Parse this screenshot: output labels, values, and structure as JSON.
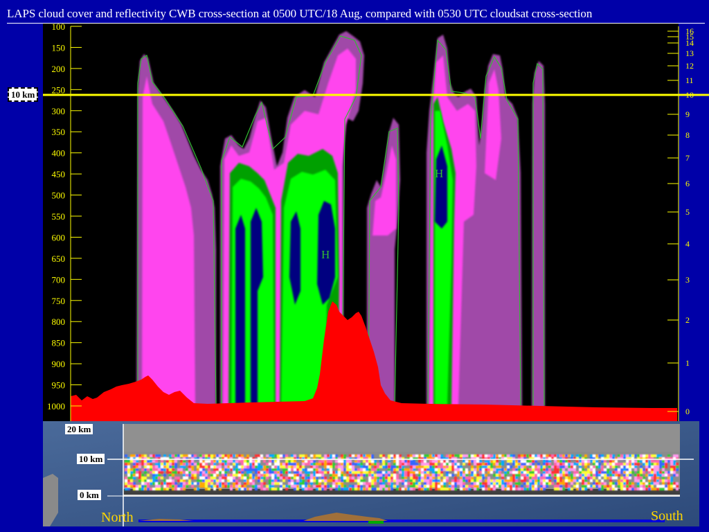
{
  "title": "LAPS cloud cover and reflectivity CWB cross-section at 0500 UTC/18 Aug, compared with 0530 UTC cloudsat cross-section",
  "chart_data": [
    {
      "type": "heatmap",
      "name": "LAPS cloud cover and reflectivity cross-section",
      "y_left_label": "",
      "y_left_ticks": [
        "100",
        "150",
        "200",
        "250",
        "300",
        "350",
        "400",
        "450",
        "500",
        "550",
        "600",
        "650",
        "700",
        "750",
        "800",
        "850",
        "900",
        "950",
        "1000"
      ],
      "y_left_range": [
        100,
        1000
      ],
      "y_right_ticks": [
        "16",
        "15",
        "14",
        "13",
        "12",
        "11",
        "10",
        "9",
        "8",
        "7",
        "6",
        "5",
        "4",
        "3",
        "2",
        "1",
        "0"
      ],
      "height_marker_label": "10 km",
      "height_marker_pressure": 278,
      "contour_labels": [
        "H",
        "H"
      ],
      "colors": {
        "background": "#000000",
        "cloud_light": "#a04aa8",
        "cloud_medium": "#ff44ee",
        "reflectivity_low": "#00b000",
        "reflectivity_mid": "#00ff00",
        "reflectivity_high": "#000080",
        "terrain": "#ff0000",
        "marker_line": "#ffff00",
        "axis": "#ffff00",
        "contour": "#33bb33"
      }
    },
    {
      "type": "heatmap",
      "name": "cloudsat cross-section",
      "height_labels": [
        "20 km",
        "10 km",
        "0 km"
      ],
      "direction_left": "North",
      "direction_right": "South",
      "colors": {
        "background": "#909090",
        "ocean": "#3a5a8a",
        "terrain": "#a0703a",
        "track": "#0000dd"
      }
    }
  ]
}
